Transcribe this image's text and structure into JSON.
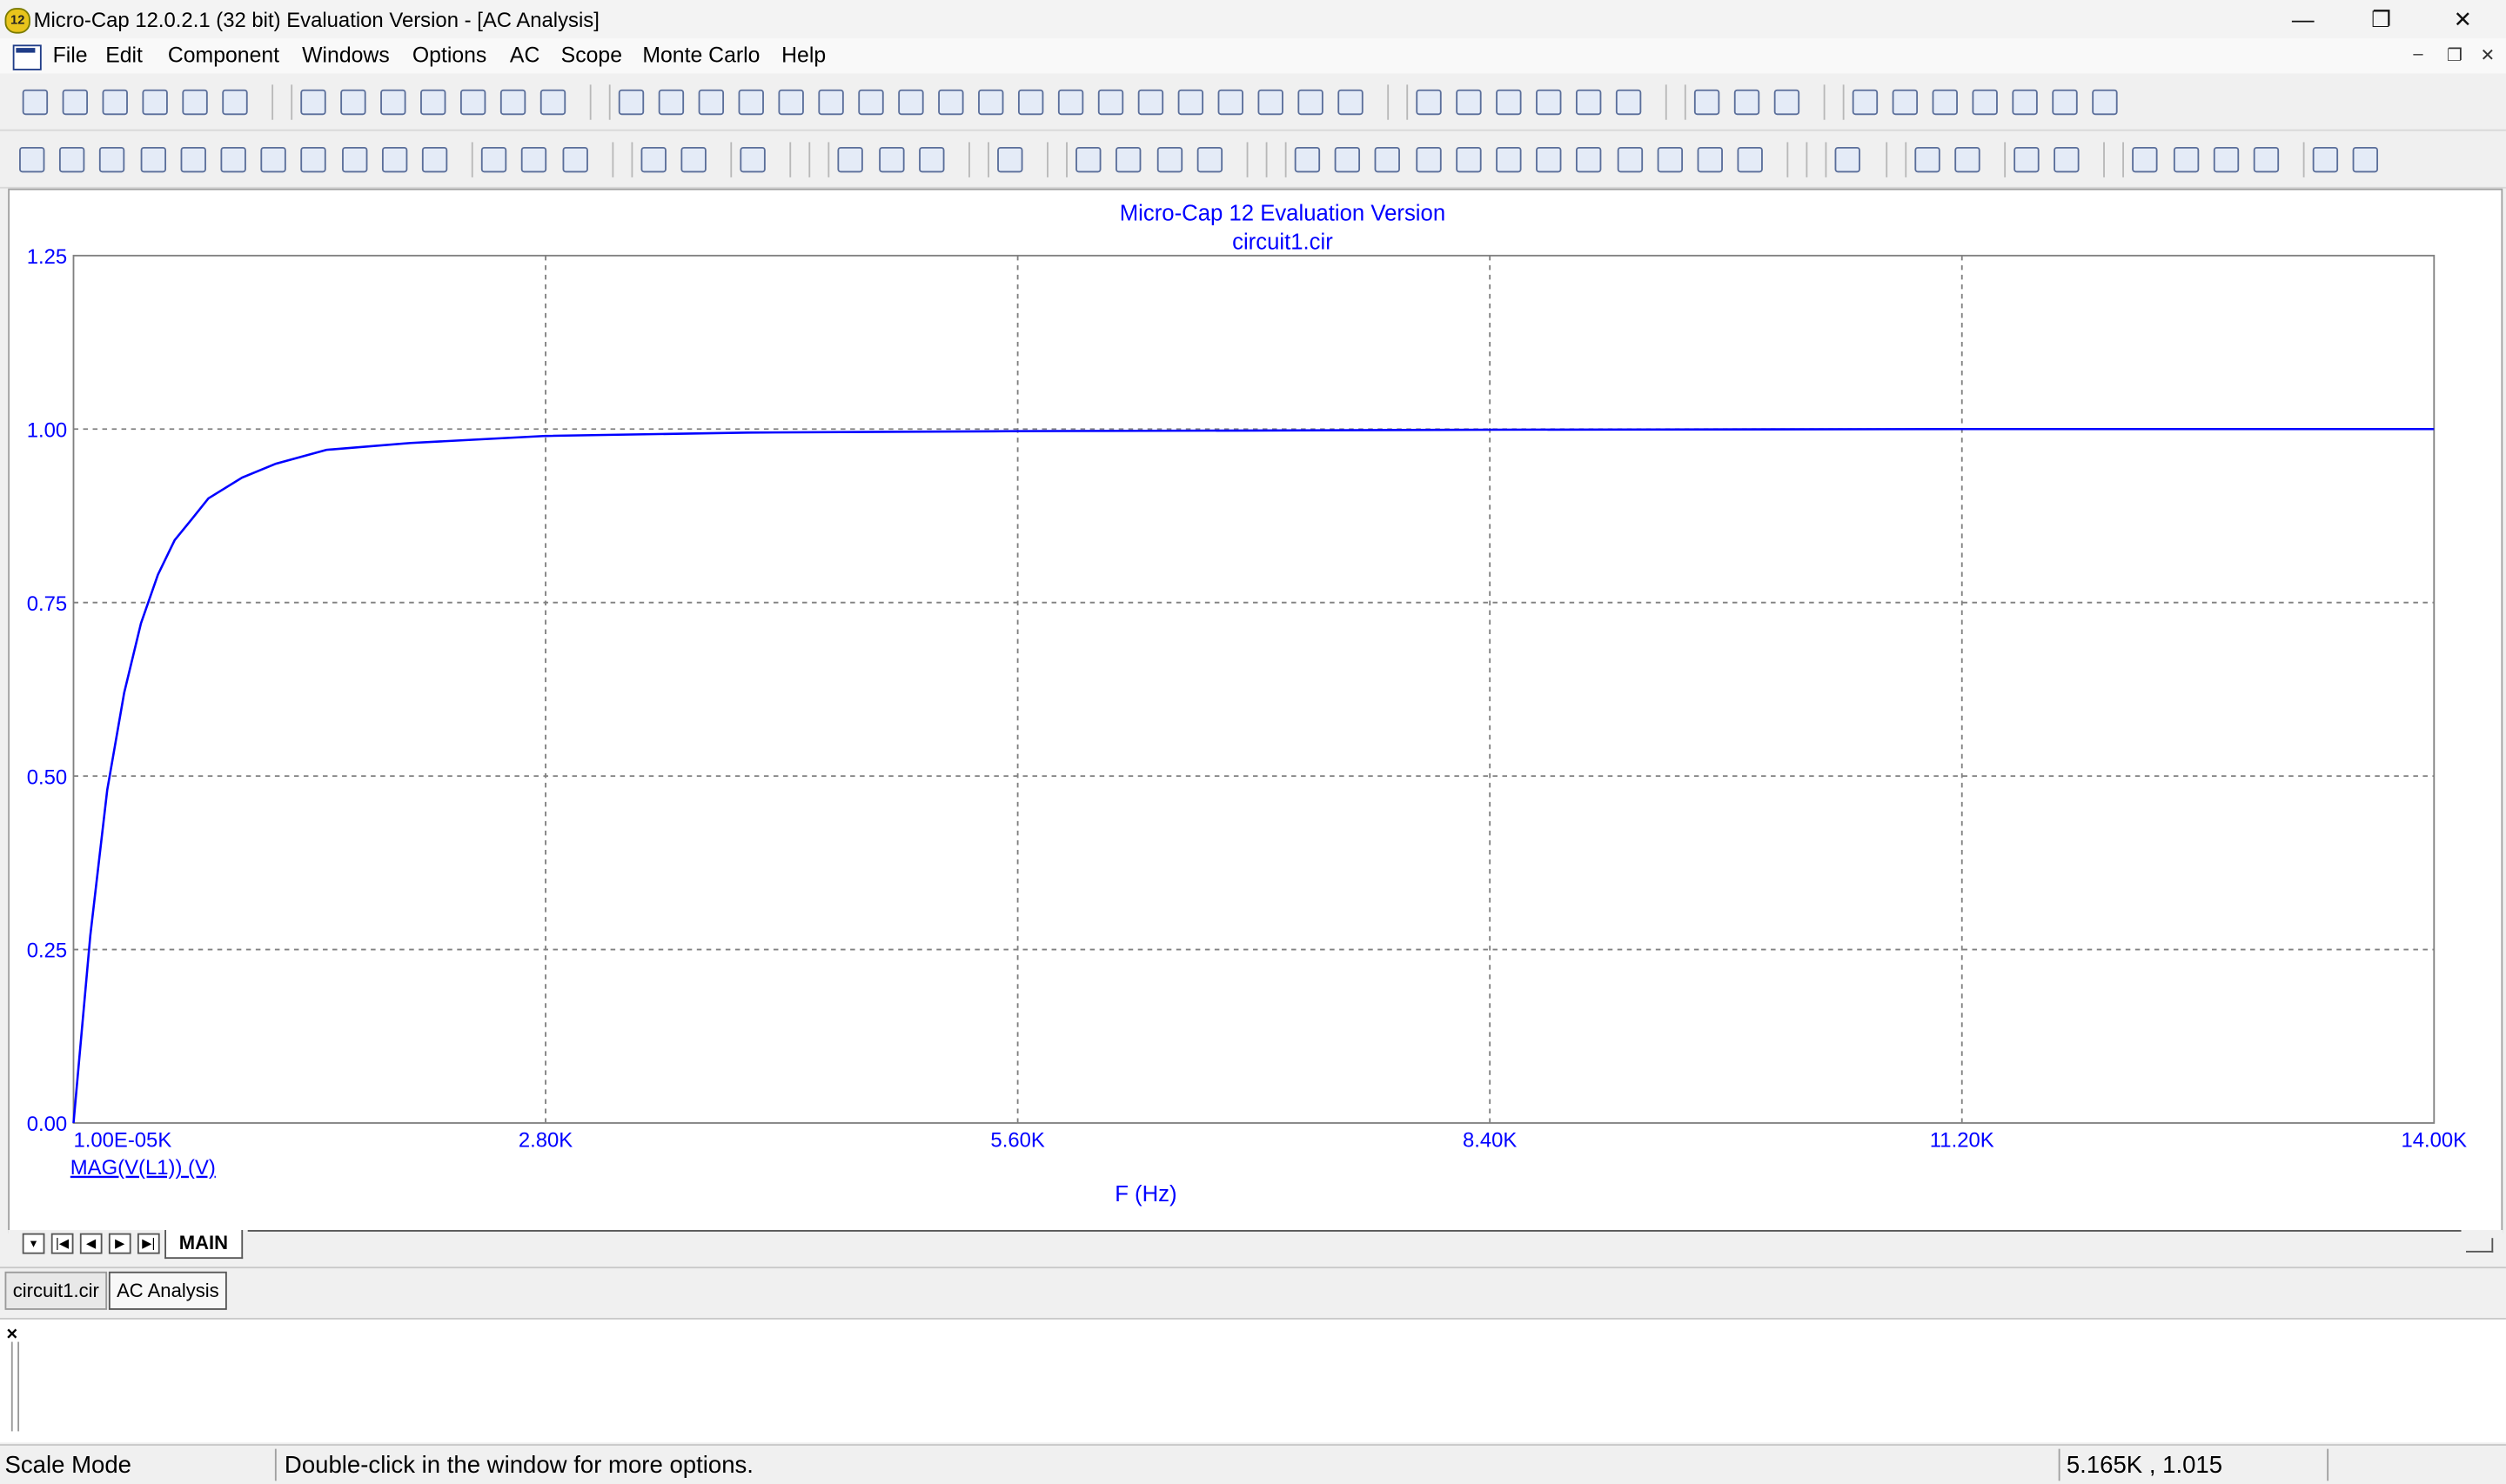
{
  "window": {
    "logo_text": "12",
    "title": "Micro-Cap 12.0.2.1 (32 bit) Evaluation Version - [AC Analysis]",
    "minimize": "—",
    "restore": "❐",
    "close": "✕"
  },
  "menu": {
    "items": [
      "File",
      "Edit",
      "Component",
      "Windows",
      "Options",
      "AC",
      "Scope",
      "Monte Carlo",
      "Help"
    ],
    "mdi_minimize": "–",
    "mdi_restore": "❐",
    "mdi_close": "✕"
  },
  "plot": {
    "title": "Micro-Cap 12 Evaluation Version",
    "subtitle": "circuit1.cir",
    "y_tick_labels": [
      "1.25",
      "1.00",
      "0.75",
      "0.50",
      "0.25",
      "0.00"
    ],
    "x_tick_labels": [
      "1.00E-05K",
      "2.80K",
      "5.60K",
      "8.40K",
      "11.20K",
      "14.00K"
    ],
    "trace_label": "MAG(V(L1)) (V)",
    "x_axis_label": "F (Hz)",
    "trace_color": "#0000ff",
    "grid_color": "#808080",
    "text_color": "#0000ff"
  },
  "chart_data": {
    "type": "line",
    "title": "Micro-Cap 12 Evaluation Version",
    "subtitle": "circuit1.cir",
    "xlabel": "F (Hz)",
    "ylabel": "MAG(V(L1)) (V)",
    "xlim": [
      0,
      14000
    ],
    "ylim": [
      0,
      1.25
    ],
    "grid": true,
    "series": [
      {
        "name": "MAG(V(L1)) (V)",
        "x": [
          0,
          100,
          200,
          300,
          400,
          500,
          600,
          700,
          800,
          1000,
          1200,
          1500,
          2000,
          2800,
          4000,
          5600,
          7000,
          8400,
          11200,
          14000
        ],
        "values": [
          0,
          0.27,
          0.48,
          0.62,
          0.72,
          0.79,
          0.84,
          0.87,
          0.9,
          0.93,
          0.95,
          0.97,
          0.98,
          0.99,
          0.995,
          0.997,
          0.998,
          0.999,
          1.0,
          1.0
        ]
      }
    ]
  },
  "sheet": {
    "nav": [
      "▾",
      "|◀",
      "◀",
      "▶",
      "▶|"
    ],
    "tab": "MAIN"
  },
  "doc_tabs": [
    "circuit1.cir",
    "AC Analysis"
  ],
  "output": {
    "close": "×"
  },
  "status": {
    "mode": "Scale Mode",
    "hint": "Double-click in the window for more options.",
    "coords": "5.165K , 1.015"
  }
}
